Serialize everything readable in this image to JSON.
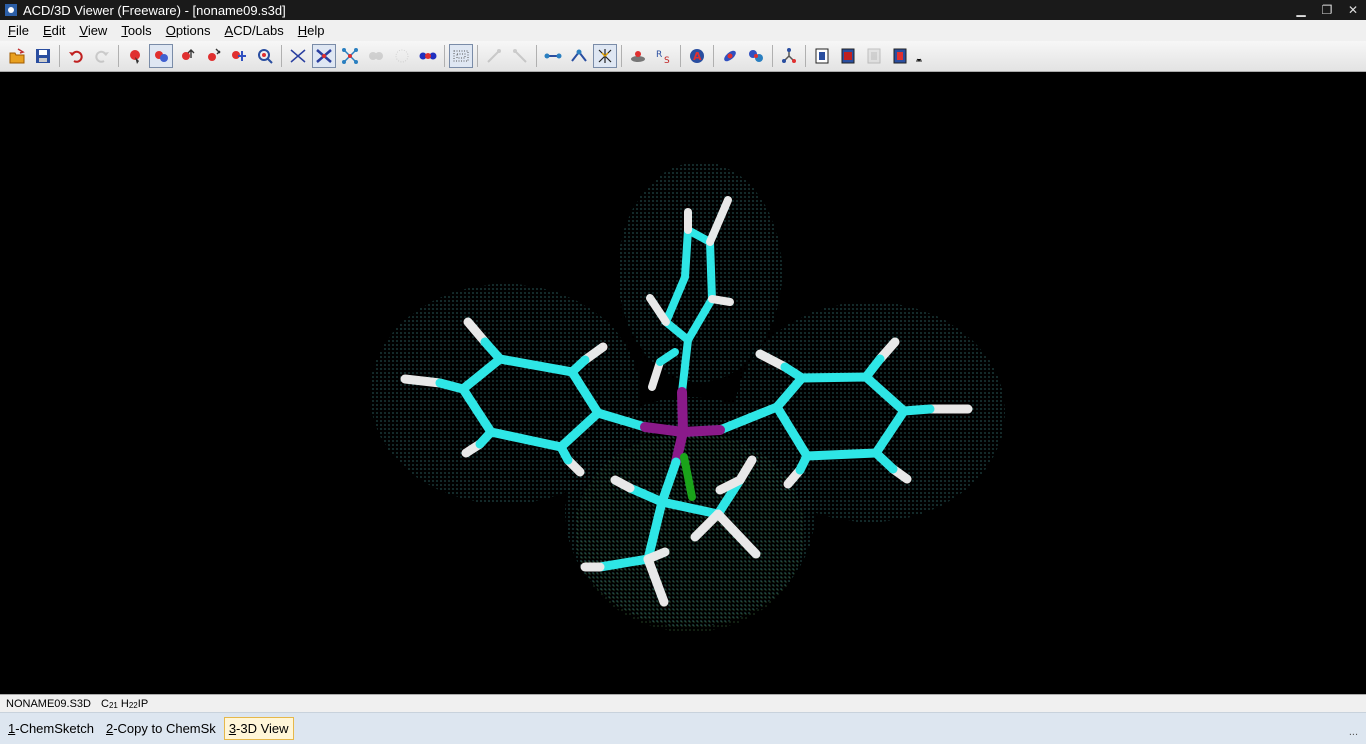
{
  "window": {
    "title": "ACD/3D Viewer (Freeware) - [noname09.s3d]",
    "minimize_glyph": "▁",
    "restore_glyph": "❐",
    "close_glyph": "✕"
  },
  "menu": [
    {
      "key": "F",
      "rest": "ile"
    },
    {
      "key": "E",
      "rest": "dit"
    },
    {
      "key": "V",
      "rest": "iew"
    },
    {
      "key": "T",
      "rest": "ools"
    },
    {
      "key": "O",
      "rest": "ptions"
    },
    {
      "key": "A",
      "rest": "CD/Labs"
    },
    {
      "key": "H",
      "rest": "elp"
    }
  ],
  "toolbar": {
    "icons": [
      "open-icon",
      "save-icon",
      "undo-icon",
      "redo-icon",
      "select-atom-icon",
      "rotate-icon",
      "move-icon",
      "zoom-icon",
      "atom-label-icon",
      "find-icon",
      "wireframe-icon",
      "sticks-icon",
      "ball-stick-icon",
      "spacefill-icon",
      "dots-icon",
      "cpk-icon",
      "surface-dots-icon",
      "measure-distance-icon",
      "measure-angle-icon",
      "bond-length-icon",
      "bond-angle-icon",
      "torsion-icon",
      "optimize-icon",
      "rs-label-icon",
      "atom-a-icon",
      "orbital-icon",
      "molecule-icon",
      "tree-icon",
      "frame1-icon",
      "frame2-icon",
      "frame3-icon",
      "frame4-icon",
      "dropdown-icon"
    ]
  },
  "status": {
    "filename": "NONAME09.S3D",
    "formula": {
      "C": "C",
      "c_count": "21",
      "H": "H",
      "h_count": "22",
      "rest": "IP"
    }
  },
  "tabs": [
    {
      "key": "1",
      "label": "-ChemSketch"
    },
    {
      "key": "2",
      "label": "-Copy to ChemSk"
    },
    {
      "key": "3",
      "label": "-3D View"
    }
  ],
  "tabbar_ellipsis": "...",
  "colors": {
    "carbon": "#2ee6e6",
    "hydrogen": "#e8e8e8",
    "phosphorus": "#8a1a8a",
    "iodine_bond": "#1aa41a",
    "surface_dots": "#66e0e0",
    "surface_dots_green": "#5fa85f"
  }
}
